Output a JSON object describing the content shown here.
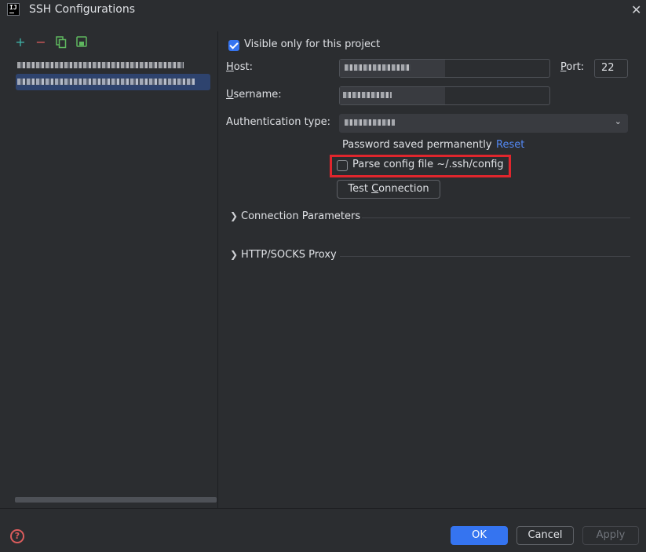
{
  "window": {
    "title": "SSH Configurations"
  },
  "icons": {
    "app": "intellij-icon",
    "close": "close-icon",
    "add": "plus-icon",
    "remove": "minus-icon",
    "copy": "copy-icon",
    "save": "save-icon",
    "help": "help-icon",
    "expand": "chevron-right-icon",
    "dropdown": "chevron-down-icon"
  },
  "colors": {
    "accent": "#3574f0",
    "highlight": "#e0262d",
    "link": "#548af7",
    "remove": "#db5c5c",
    "add": "#3fb2a8"
  },
  "form": {
    "visible_only": {
      "label": "Visible only for this project",
      "checked": true
    },
    "host": {
      "label_prefix": "H",
      "label_rest": "ost:"
    },
    "port": {
      "label_prefix": "P",
      "label_rest": "ort:",
      "value": "22"
    },
    "username": {
      "label_prefix": "U",
      "label_rest": "sername:"
    },
    "auth": {
      "label": "Authentication type:"
    },
    "password_status": "Password saved permanently",
    "reset_link": "Reset",
    "parse_config": {
      "label": "Parse config file ~/.ssh/config",
      "checked": false
    },
    "test_connection": {
      "label_prefix": "Test ",
      "label_underline": "C",
      "label_rest": "onnection"
    }
  },
  "sections": [
    {
      "title": "Connection Parameters"
    },
    {
      "title": "HTTP/SOCKS Proxy"
    }
  ],
  "buttons": {
    "ok": "OK",
    "cancel": "Cancel",
    "apply": "Apply"
  }
}
